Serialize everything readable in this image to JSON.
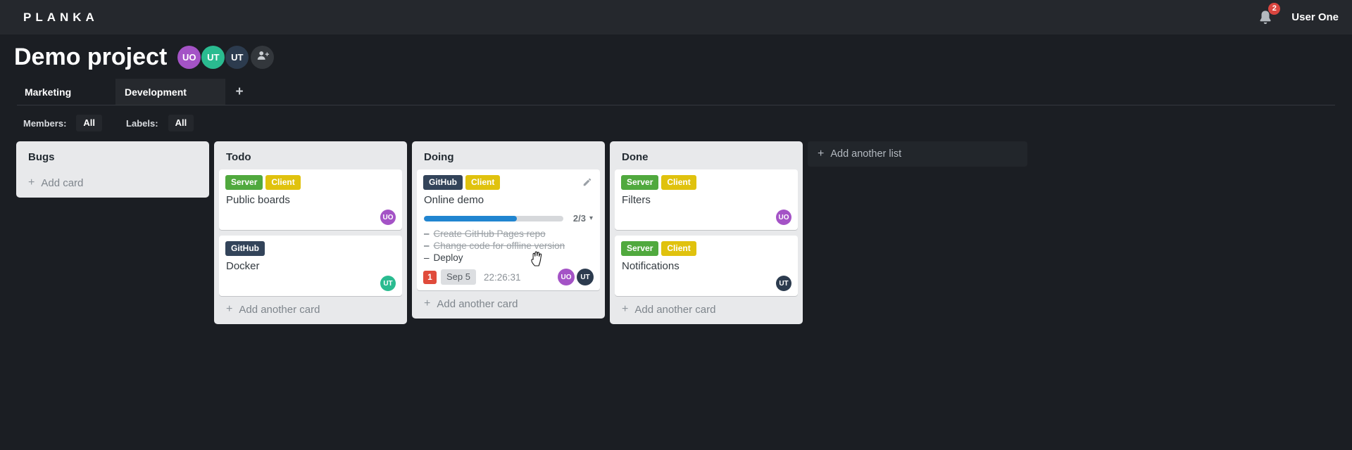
{
  "topbar": {
    "logo": "PLANKA",
    "user": "User One",
    "notifications": "2"
  },
  "project": {
    "title": "Demo project",
    "members": [
      {
        "initials": "UO",
        "color": "#a453c6"
      },
      {
        "initials": "UT",
        "color": "#2abb90"
      },
      {
        "initials": "UT",
        "color": "#2c3b4e"
      }
    ]
  },
  "tabs": [
    {
      "label": "Marketing",
      "active": false
    },
    {
      "label": "Development",
      "active": true
    }
  ],
  "filters": {
    "members_label": "Members:",
    "members_value": "All",
    "labels_label": "Labels:",
    "labels_value": "All"
  },
  "board": {
    "add_list_label": "Add another list",
    "lists": [
      {
        "title": "Bugs",
        "add_card_label": "Add card",
        "cards": []
      },
      {
        "title": "Todo",
        "add_card_label": "Add another card",
        "cards": [
          {
            "title": "Public boards",
            "labels": [
              {
                "name": "Server",
                "color": "#50a93e"
              },
              {
                "name": "Client",
                "color": "#e0c20e"
              }
            ],
            "members": [
              {
                "initials": "UO",
                "color": "#a453c6"
              }
            ]
          },
          {
            "title": "Docker",
            "labels": [
              {
                "name": "GitHub",
                "color": "#33445a"
              }
            ],
            "members": [
              {
                "initials": "UT",
                "color": "#2abb90"
              }
            ]
          }
        ]
      },
      {
        "title": "Doing",
        "add_card_label": "Add another card",
        "cards": [
          {
            "title": "Online demo",
            "labels": [
              {
                "name": "GitHub",
                "color": "#33445a"
              },
              {
                "name": "Client",
                "color": "#e0c20e"
              }
            ],
            "progress": {
              "completed": 2,
              "total": 3,
              "text": "2/3"
            },
            "tasks": [
              {
                "text": "Create GitHub Pages repo",
                "done": true
              },
              {
                "text": "Change code for offline version",
                "done": true
              },
              {
                "text": "Deploy",
                "done": false
              }
            ],
            "notifications": "1",
            "due_date": "Sep 5",
            "stopwatch": "22:26:31",
            "members": [
              {
                "initials": "UO",
                "color": "#a453c6"
              },
              {
                "initials": "UT",
                "color": "#2c3b4e"
              }
            ]
          }
        ]
      },
      {
        "title": "Done",
        "add_card_label": "Add another card",
        "cards": [
          {
            "title": "Filters",
            "labels": [
              {
                "name": "Server",
                "color": "#50a93e"
              },
              {
                "name": "Client",
                "color": "#e0c20e"
              }
            ],
            "members": [
              {
                "initials": "UO",
                "color": "#a453c6"
              }
            ]
          },
          {
            "title": "Notifications",
            "labels": [
              {
                "name": "Server",
                "color": "#50a93e"
              },
              {
                "name": "Client",
                "color": "#e0c20e"
              }
            ],
            "members": [
              {
                "initials": "UT",
                "color": "#2c3b4e"
              }
            ]
          }
        ]
      }
    ]
  },
  "icons": {
    "plus": "+",
    "caret_down": "▾",
    "dash": "–"
  },
  "colors": {
    "topbar_bg": "#25282d",
    "page_bg": "#1b1e23",
    "list_bg": "#e8e9eb",
    "accent_blue": "#2185d0",
    "label_green": "#50a93e",
    "label_yellow": "#e0c20e",
    "label_navy": "#33445a",
    "badge_red": "#e04b3b",
    "notification_red": "#d9453f",
    "avatar_purple": "#a453c6",
    "avatar_teal": "#2abb90",
    "avatar_navy": "#2c3b4e"
  }
}
